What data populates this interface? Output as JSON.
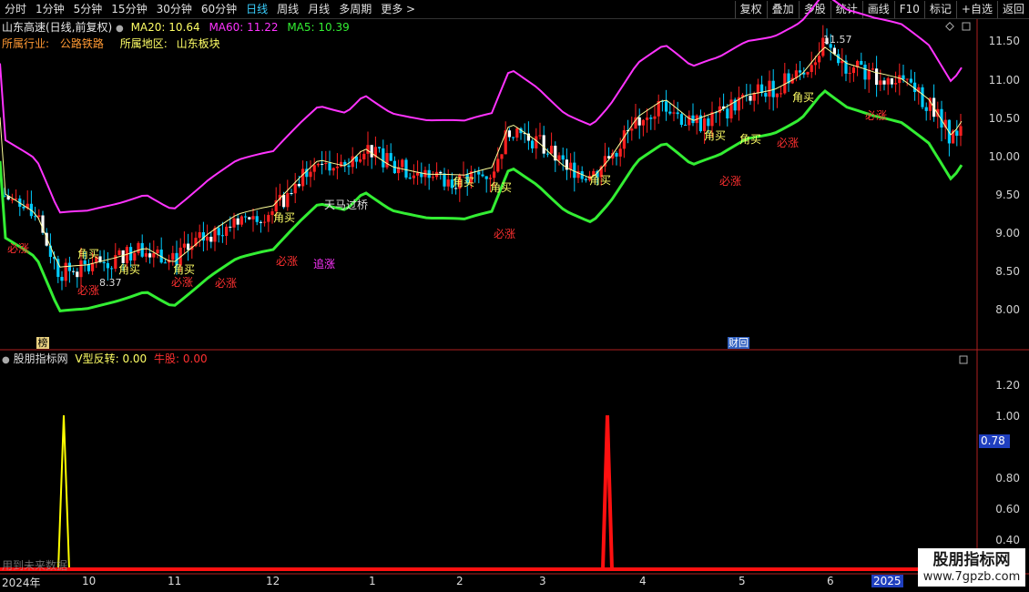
{
  "toolbar": {
    "periods": [
      "分时",
      "1分钟",
      "5分钟",
      "15分钟",
      "30分钟",
      "60分钟",
      "日线",
      "周线",
      "月线",
      "多周期",
      "更多 >"
    ],
    "active": "日线",
    "buttons": [
      "复权",
      "叠加",
      "多股",
      "统计",
      "画线",
      "F10",
      "标记",
      "+自选",
      "返回"
    ]
  },
  "header": {
    "stock": "山东高速(日线,前复权)",
    "ma20_label": "MA20: 10.64",
    "ma60_label": "MA60: 11.22",
    "ma5_label": "MA5: 10.39",
    "industry_key": "所属行业:",
    "industry_val": "公路铁路",
    "region_key": "所属地区:",
    "region_val": "山东板块"
  },
  "indicator": {
    "name": "股朋指标网",
    "v_label": "V型反转: 0.00",
    "bull_label": "牛股: 0.00",
    "cursor_value": "0.78",
    "bottom_note": "用到未来数据"
  },
  "price_axis": [
    "11.50",
    "11.00",
    "10.50",
    "10.00",
    "9.50",
    "9.00",
    "8.50",
    "8.00"
  ],
  "ind_axis": [
    "1.20",
    "1.00",
    "0.80",
    "0.60",
    "0.40",
    "0.20"
  ],
  "months": [
    "2024年",
    "10",
    "11",
    "12",
    "1",
    "2",
    "3",
    "4",
    "5",
    "6",
    "2025"
  ],
  "annotations": {
    "high": "11.57",
    "low": "8.37",
    "jiaomai": "角买",
    "bizhang": "必涨",
    "zhuizhang": "追涨",
    "tianma": "天马过桥",
    "bang": "榜",
    "caihui": "财回"
  },
  "watermark": {
    "line1": "股朋指标网",
    "line2": "www.7gpzb.com"
  },
  "colors": {
    "up": "#ff2020",
    "down": "#00ccff",
    "ma60": "#ff33ff",
    "ma20": "#ffff66",
    "band_low": "#33ee33",
    "yellow": "#ffff00"
  },
  "chart_data": {
    "type": "line",
    "series": [
      {
        "name": "V型反转",
        "peak_value": 1.0
      },
      {
        "name": "牛股",
        "peak_value": 1.0
      }
    ],
    "ylim": [
      0,
      1.4
    ]
  }
}
